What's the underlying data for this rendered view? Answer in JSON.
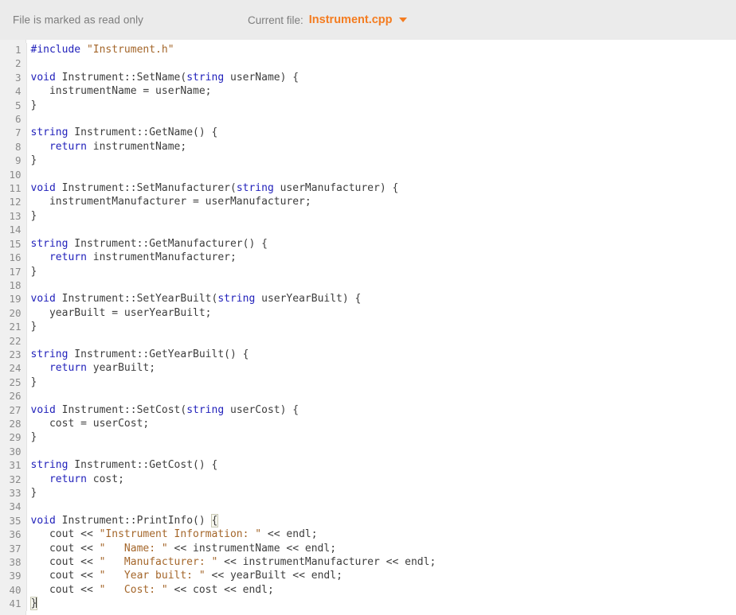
{
  "header": {
    "readonly_notice": "File is marked as read only",
    "current_file_label": "Current file:",
    "current_file_name": "Instrument.cpp",
    "caret_icon": "chevron-down-icon",
    "accent_color": "#f47c20",
    "background_color": "#ebebeb",
    "muted_text_color": "#7d7d7d"
  },
  "editor": {
    "language": "cpp",
    "line_count": 41,
    "first_line_number": 1,
    "gutter_background": "#f0f0f0",
    "gutter_text_color": "#8a8a8a",
    "code_background": "#ffffff",
    "colors": {
      "keyword": "#2222bb",
      "string": "#a4662a",
      "plain": "#3d3d3d",
      "bracket_match_outline": "#c8c8b4"
    },
    "cursor_line": 41,
    "matching_brackets": [
      35,
      41
    ],
    "lines": [
      {
        "n": 1,
        "text": "#include \"Instrument.h\""
      },
      {
        "n": 2,
        "text": ""
      },
      {
        "n": 3,
        "text": "void Instrument::SetName(string userName) {"
      },
      {
        "n": 4,
        "text": "   instrumentName = userName;"
      },
      {
        "n": 5,
        "text": "}"
      },
      {
        "n": 6,
        "text": ""
      },
      {
        "n": 7,
        "text": "string Instrument::GetName() {"
      },
      {
        "n": 8,
        "text": "   return instrumentName;"
      },
      {
        "n": 9,
        "text": "}"
      },
      {
        "n": 10,
        "text": ""
      },
      {
        "n": 11,
        "text": "void Instrument::SetManufacturer(string userManufacturer) {"
      },
      {
        "n": 12,
        "text": "   instrumentManufacturer = userManufacturer;"
      },
      {
        "n": 13,
        "text": "}"
      },
      {
        "n": 14,
        "text": ""
      },
      {
        "n": 15,
        "text": "string Instrument::GetManufacturer() {"
      },
      {
        "n": 16,
        "text": "   return instrumentManufacturer;"
      },
      {
        "n": 17,
        "text": "}"
      },
      {
        "n": 18,
        "text": ""
      },
      {
        "n": 19,
        "text": "void Instrument::SetYearBuilt(string userYearBuilt) {"
      },
      {
        "n": 20,
        "text": "   yearBuilt = userYearBuilt;"
      },
      {
        "n": 21,
        "text": "}"
      },
      {
        "n": 22,
        "text": ""
      },
      {
        "n": 23,
        "text": "string Instrument::GetYearBuilt() {"
      },
      {
        "n": 24,
        "text": "   return yearBuilt;"
      },
      {
        "n": 25,
        "text": "}"
      },
      {
        "n": 26,
        "text": ""
      },
      {
        "n": 27,
        "text": "void Instrument::SetCost(string userCost) {"
      },
      {
        "n": 28,
        "text": "   cost = userCost;"
      },
      {
        "n": 29,
        "text": "}"
      },
      {
        "n": 30,
        "text": ""
      },
      {
        "n": 31,
        "text": "string Instrument::GetCost() {"
      },
      {
        "n": 32,
        "text": "   return cost;"
      },
      {
        "n": 33,
        "text": "}"
      },
      {
        "n": 34,
        "text": ""
      },
      {
        "n": 35,
        "text": "void Instrument::PrintInfo() {"
      },
      {
        "n": 36,
        "text": "   cout << \"Instrument Information: \" << endl;"
      },
      {
        "n": 37,
        "text": "   cout << \"   Name: \" << instrumentName << endl;"
      },
      {
        "n": 38,
        "text": "   cout << \"   Manufacturer: \" << instrumentManufacturer << endl;"
      },
      {
        "n": 39,
        "text": "   cout << \"   Year built: \" << yearBuilt << endl;"
      },
      {
        "n": 40,
        "text": "   cout << \"   Cost: \" << cost << endl;"
      },
      {
        "n": 41,
        "text": "}"
      }
    ]
  }
}
